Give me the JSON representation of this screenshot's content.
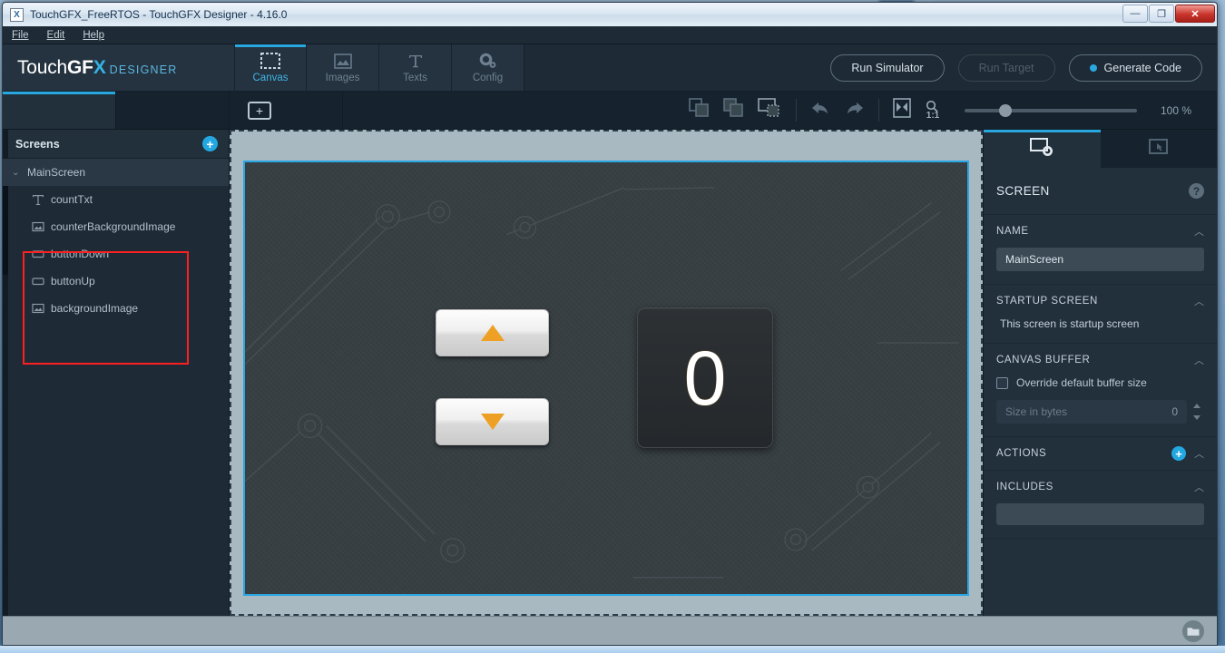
{
  "window": {
    "title": "TouchGFX_FreeRTOS - TouchGFX Designer - 4.16.0",
    "app_icon": "X",
    "minimize": "—",
    "restore": "❐",
    "close": "✕"
  },
  "menubar": {
    "items": [
      {
        "label": "File"
      },
      {
        "label": "Edit"
      },
      {
        "label": "Help"
      }
    ]
  },
  "header": {
    "logo_touch": "Touch",
    "logo_gfx": "GF",
    "logo_x": "X",
    "logo_designer": "DESIGNER",
    "tabs": [
      {
        "label": "Canvas",
        "icon": "canvas-icon",
        "active": true
      },
      {
        "label": "Images",
        "icon": "images-icon",
        "active": false
      },
      {
        "label": "Texts",
        "icon": "texts-icon",
        "active": false
      },
      {
        "label": "Config",
        "icon": "config-icon",
        "active": false
      }
    ],
    "buttons": [
      {
        "label": "Run Simulator",
        "state": "enabled"
      },
      {
        "label": "Run Target",
        "state": "disabled"
      },
      {
        "label": "Generate Code",
        "state": "enabled",
        "dot_color": "#2aa8e2"
      }
    ]
  },
  "toolbar": {
    "add_widget": "+",
    "icons": [
      "bring-to-front-icon",
      "send-to-back-icon",
      "select-region-icon",
      "undo-icon",
      "redo-icon",
      "fit-to-screen-icon",
      "zoom-one-to-one-icon"
    ],
    "ratio_label": "1:1",
    "zoom_value": "100 %"
  },
  "left_panel": {
    "tabs": [
      {
        "icon": "screen-select-icon",
        "active": true
      },
      {
        "icon": "sliders-icon",
        "active": false
      }
    ],
    "header": "Screens",
    "add_button": "+",
    "tree": [
      {
        "label": "MainScreen",
        "icon": "caret-down-icon",
        "level": 0,
        "selected": true
      },
      {
        "label": "countTxt",
        "icon": "text-widget-icon",
        "level": 1,
        "selected": false
      },
      {
        "label": "counterBackgroundImage",
        "icon": "image-widget-icon",
        "level": 1,
        "selected": false
      },
      {
        "label": "buttonDown",
        "icon": "button-widget-icon",
        "level": 1,
        "selected": false
      },
      {
        "label": "buttonUp",
        "icon": "button-widget-icon",
        "level": 1,
        "selected": false
      },
      {
        "label": "backgroundImage",
        "icon": "image-widget-icon",
        "level": 1,
        "selected": false
      }
    ],
    "annotation": {
      "type": "red-rectangle",
      "color": "#fc2020"
    }
  },
  "canvas": {
    "screen_border_color": "#2aa6e2",
    "background_color": "#373f43",
    "widgets": {
      "button_up": {
        "name": "buttonUp",
        "glyph": "triangle-up",
        "color": "#eda024"
      },
      "button_down": {
        "name": "buttonDown",
        "glyph": "triangle-down",
        "color": "#eda024"
      },
      "counter": {
        "name": "countTxt",
        "value": "0"
      }
    }
  },
  "right_panel": {
    "tabs": [
      {
        "icon": "screen-properties-icon",
        "active": true
      },
      {
        "icon": "interactions-icon",
        "active": false
      }
    ],
    "title": "SCREEN",
    "help": "?",
    "sections": [
      {
        "key": "name",
        "header": "NAME"
      },
      {
        "key": "startup",
        "header": "STARTUP SCREEN"
      },
      {
        "key": "buffer",
        "header": "CANVAS BUFFER"
      },
      {
        "key": "actions",
        "header": "ACTIONS"
      },
      {
        "key": "includes",
        "header": "INCLUDES"
      }
    ],
    "name_value": "MainScreen",
    "startup_text": "This screen is startup screen",
    "buffer_checkbox_label": "Override default buffer size",
    "buffer_checked": false,
    "buffer_placeholder": "Size in bytes",
    "buffer_value": "0",
    "actions_add": "+",
    "includes_value": ""
  },
  "status_bar": {
    "folder_icon": "folder-icon"
  },
  "background_browser": {
    "tabs": [
      {
        "title": "",
        "close": "×"
      },
      {
        "title": "",
        "close": "×"
      },
      {
        "title": "",
        "close": "×"
      }
    ],
    "new_tab": "○"
  }
}
